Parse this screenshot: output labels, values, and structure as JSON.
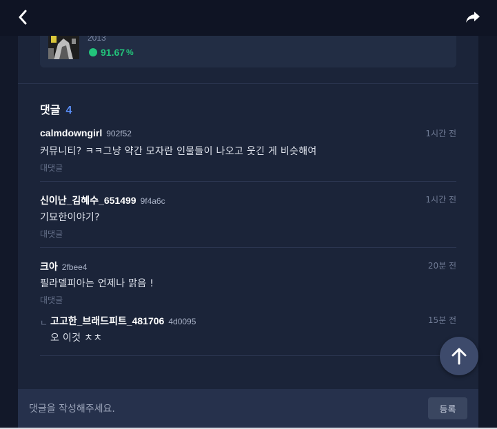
{
  "album": {
    "year": "2013",
    "rating_value": "91.67",
    "rating_unit": "%",
    "rating_color": "#22c47b"
  },
  "comments_section": {
    "title": "댓글",
    "count": "4",
    "count_color": "#5b8ff9"
  },
  "comments": [
    {
      "author": "calmdowngirl",
      "hash": "902f52",
      "time": "1시간 전",
      "text": "커뮤니티? ㅋㅋ그냥 약간 모자란 인물들이 나오고 웃긴 게 비슷해여",
      "reply_label": "대댓글"
    },
    {
      "author": "신이난_김혜수_651499",
      "hash": "9f4a6c",
      "time": "1시간 전",
      "text": "기묘한이야기?",
      "reply_label": "대댓글"
    },
    {
      "author": "크아",
      "hash": "2fbee4",
      "time": "20분 전",
      "text": "필라델피아는 언제나 맑음 !",
      "reply_label": "대댓글"
    }
  ],
  "reply": {
    "marker": "ㄴ",
    "author": "고고한_브래드피트_481706",
    "hash": "4d0095",
    "time": "15분 전",
    "text": "오 이것 ㅊㅊ"
  },
  "compose": {
    "placeholder": "댓글을 작성해주세요.",
    "submit_label": "등록"
  },
  "icons": {
    "back": "chevron-left-icon",
    "share": "share-arrow-icon",
    "scroll_top": "arrow-up-icon"
  }
}
